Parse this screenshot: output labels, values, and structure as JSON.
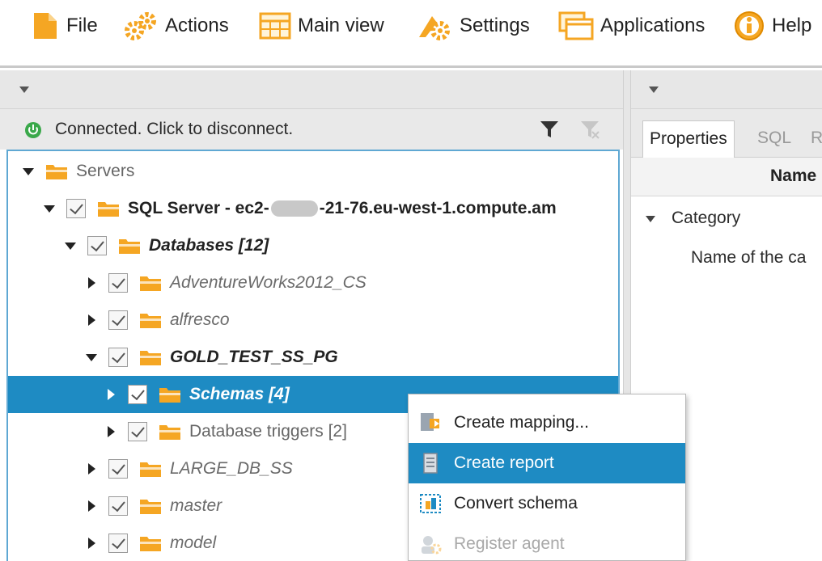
{
  "menu": {
    "items": [
      {
        "label": "File",
        "icon": "file-icon"
      },
      {
        "label": "Actions",
        "icon": "gears-icon"
      },
      {
        "label": "Main view",
        "icon": "grid-icon"
      },
      {
        "label": "Settings",
        "icon": "settings-icon"
      },
      {
        "label": "Applications",
        "icon": "windows-icon"
      },
      {
        "label": "Help",
        "icon": "help-icon"
      }
    ]
  },
  "left_pane": {
    "status_text": "Connected. Click to disconnect.",
    "status_color": "#3aa84a",
    "tree": [
      {
        "label": "Servers",
        "style": "gray"
      },
      {
        "label_prefix": "SQL Server - ec2-",
        "label_suffix": "-21-76.eu-west-1.compute.am",
        "style": "bold"
      },
      {
        "label": "Databases [12]",
        "style": "bi"
      },
      {
        "label": "AdventureWorks2012_CS",
        "style": "it"
      },
      {
        "label": "alfresco",
        "style": "it"
      },
      {
        "label": "GOLD_TEST_SS_PG",
        "style": "bi"
      },
      {
        "label": "Schemas [4]",
        "style": "bi"
      },
      {
        "label": "Database triggers [2]",
        "style": "gray"
      },
      {
        "label": "LARGE_DB_SS",
        "style": "it"
      },
      {
        "label": "master",
        "style": "it"
      },
      {
        "label": "model",
        "style": "it"
      }
    ]
  },
  "right_pane": {
    "tabs": [
      "Properties",
      "SQL",
      "R"
    ],
    "column_header": "Name",
    "category_label": "Category",
    "category_value": "Name of the ca"
  },
  "context_menu": {
    "items": [
      {
        "label": "Create mapping...",
        "icon": "mapping-icon"
      },
      {
        "label": "Create report",
        "icon": "report-icon"
      },
      {
        "label": "Convert schema",
        "icon": "convert-icon"
      },
      {
        "label": "Register agent",
        "icon": "agent-icon"
      }
    ]
  },
  "colors": {
    "selection": "#1e8bc3",
    "folder": "#f5a623",
    "tree_border": "#5fa8d3"
  }
}
